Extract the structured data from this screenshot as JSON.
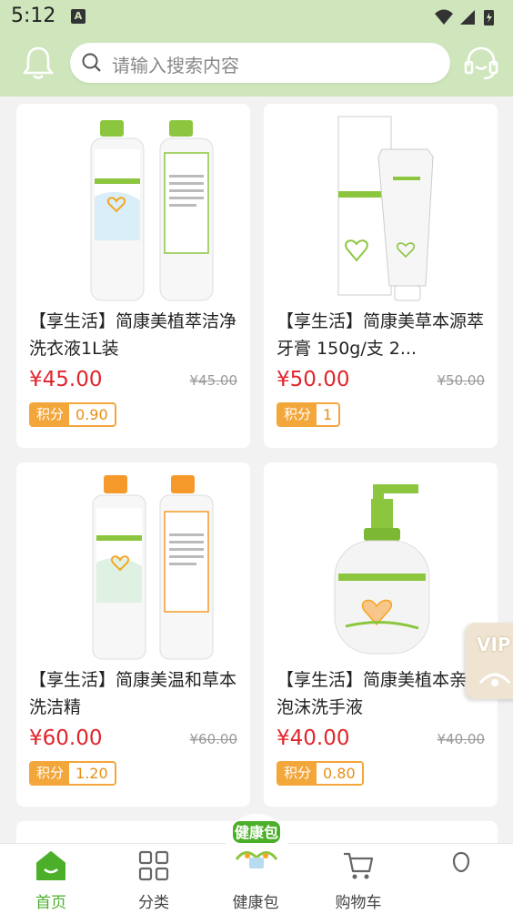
{
  "status_bar": {
    "time": "5:12",
    "sim_label": "A"
  },
  "header": {
    "search_placeholder": "请输入搜索内容"
  },
  "products": [
    {
      "title": "【享生活】简康美植萃洁净洗衣液1L装",
      "price": "¥45.00",
      "original_price": "¥45.00",
      "points_label": "积分",
      "points": "0.90",
      "accent": "#8cc63f"
    },
    {
      "title": "【享生活】简康美草本源萃牙膏 150g/支 2...",
      "price": "¥50.00",
      "original_price": "¥50.00",
      "points_label": "积分",
      "points": "1",
      "accent": "#8cc63f"
    },
    {
      "title": "【享生活】简康美温和草本洗洁精",
      "price": "¥60.00",
      "original_price": "¥60.00",
      "points_label": "积分",
      "points": "1.20",
      "accent": "#f59a2a"
    },
    {
      "title": "【享生活】简康美植本亲肤泡沫洗手液",
      "price": "¥40.00",
      "original_price": "¥40.00",
      "points_label": "积分",
      "points": "0.80",
      "accent": "#8cc63f"
    }
  ],
  "vip_badge": "VIP",
  "bottom_nav": [
    {
      "label": "首页",
      "icon": "home-icon",
      "active": true
    },
    {
      "label": "分类",
      "icon": "category-icon",
      "active": false
    },
    {
      "label": "健康包",
      "icon": "health-pack-icon",
      "active": false
    },
    {
      "label": "购物车",
      "icon": "cart-icon",
      "active": false
    },
    {
      "label": "",
      "icon": "profile-icon",
      "active": false
    }
  ],
  "colors": {
    "header_bg": "#cfe6bd",
    "price": "#e0262d",
    "points": "#f3a63a",
    "active_nav": "#4caf2a"
  }
}
